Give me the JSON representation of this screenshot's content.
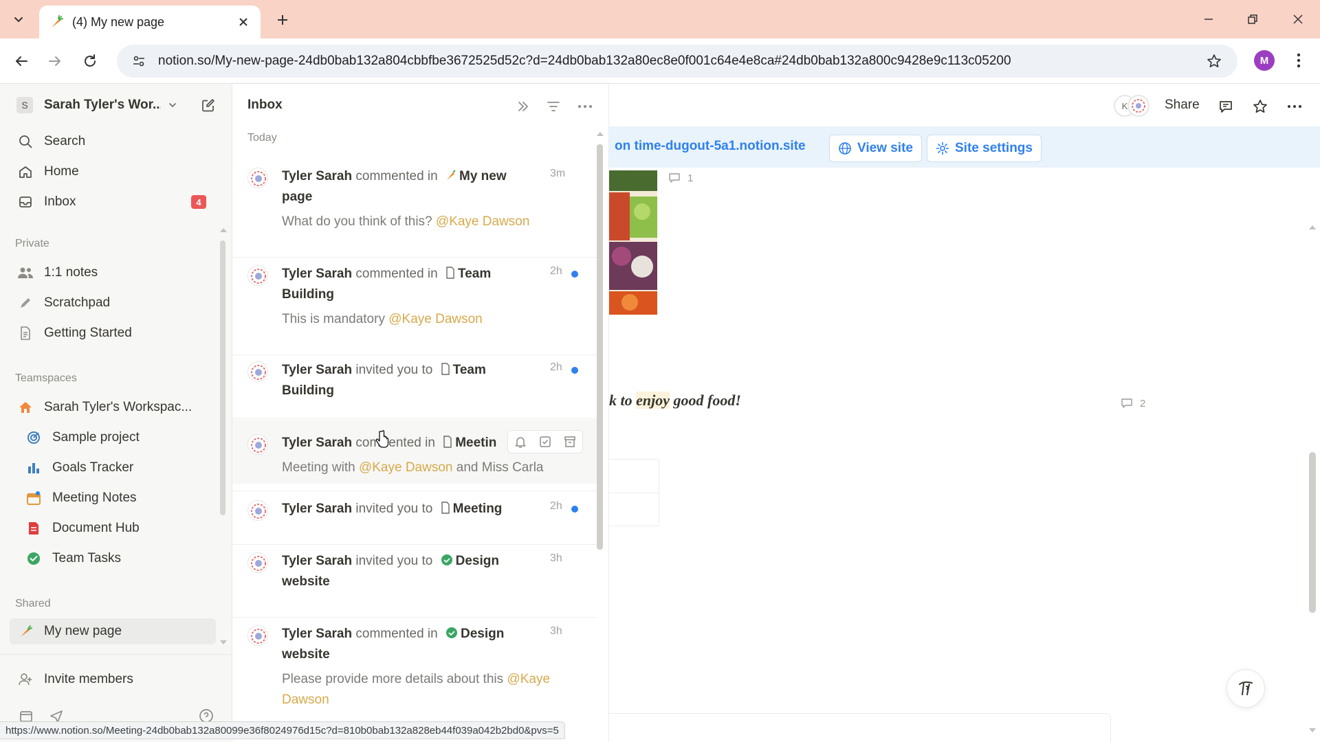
{
  "browser": {
    "tab_title": "(4) My new page",
    "url": "notion.so/My-new-page-24db0bab132a804cbbfbe3672525d52c?d=24db0bab132a80ec8e0f001c64e4e8ca#24db0bab132a800c9428e9c113c05200",
    "profile_initial": "M",
    "status_url": "https://www.notion.so/Meeting-24db0bab132a80099e36f8024976d15c?d=810b0bab132a828eb44f039a042b2bd0&pvs=5",
    "accent_color": "#f9d3c6"
  },
  "sidebar": {
    "workspace_initial": "S",
    "workspace_name": "Sarah Tyler's Wor...",
    "top_items": [
      {
        "label": "Search",
        "icon": "search-icon"
      },
      {
        "label": "Home",
        "icon": "home-icon"
      },
      {
        "label": "Inbox",
        "icon": "inbox-icon",
        "badge": "4"
      }
    ],
    "private_label": "Private",
    "private_items": [
      {
        "label": "1:1 notes",
        "icon": "people-icon"
      },
      {
        "label": "Scratchpad",
        "icon": "pencil-icon"
      },
      {
        "label": "Getting Started",
        "icon": "document-icon"
      }
    ],
    "teamspaces_label": "Teamspaces",
    "teamspace_name": "Sarah Tyler's Workspac...",
    "teamspace_items": [
      {
        "label": "Sample project",
        "icon": "target-icon"
      },
      {
        "label": "Goals Tracker",
        "icon": "chart-icon"
      },
      {
        "label": "Meeting Notes",
        "icon": "calendar-icon"
      },
      {
        "label": "Document Hub",
        "icon": "document-hub-icon"
      },
      {
        "label": "Team Tasks",
        "icon": "check-circle-icon"
      }
    ],
    "shared_label": "Shared",
    "shared_items": [
      {
        "label": "My new page",
        "icon": "carrot-icon"
      }
    ],
    "invite_label": "Invite members"
  },
  "inbox": {
    "title": "Inbox",
    "today_label": "Today",
    "notifications": [
      {
        "who": "Tyler Sarah",
        "action": "commented in",
        "page_line1": "My new",
        "page_line2": "page",
        "preview": "What do you think of this?",
        "mention": "@Kaye Dawson",
        "time": "3m"
      },
      {
        "who": "Tyler Sarah",
        "action": "commented in",
        "page_line1": "Team",
        "page_line2": "Building",
        "preview": "This is mandatory",
        "mention": "@Kaye Dawson",
        "time": "2h"
      },
      {
        "who": "Tyler Sarah",
        "action": "invited you to",
        "page_line1": "Team",
        "page_line2": "Building",
        "time": "2h"
      },
      {
        "who": "Tyler Sarah",
        "action_a": "com",
        "action_b": "ented in",
        "page_line1": "Meetin",
        "preview_a": "Meeting with",
        "mention": "@Kaye Dawson",
        "preview_b": "and Miss Carla"
      },
      {
        "who": "Tyler Sarah",
        "action": "invited you to",
        "page_line1": "Meeting",
        "time": "2h"
      },
      {
        "who": "Tyler Sarah",
        "action": "invited you to",
        "page_line1": "Design",
        "page_line2": "website",
        "time": "3h"
      },
      {
        "who": "Tyler Sarah",
        "action": "commented in",
        "page_line1": "Design",
        "page_line2": "website",
        "preview": "Please provide more details about this",
        "mention_a": "@Kaye",
        "mention_b": "Dawson",
        "time": "3h"
      }
    ]
  },
  "page": {
    "facepile_initial": "K",
    "share_label": "Share",
    "publish_text": "on time-dugout-5a1.notion.site",
    "view_site_label": "View site",
    "site_settings_label": "Site settings",
    "comment_count_1": "1",
    "comment_count_2": "2",
    "quote_a": "k to ",
    "quote_highlight": "enjoy",
    "quote_b": " good food!"
  }
}
